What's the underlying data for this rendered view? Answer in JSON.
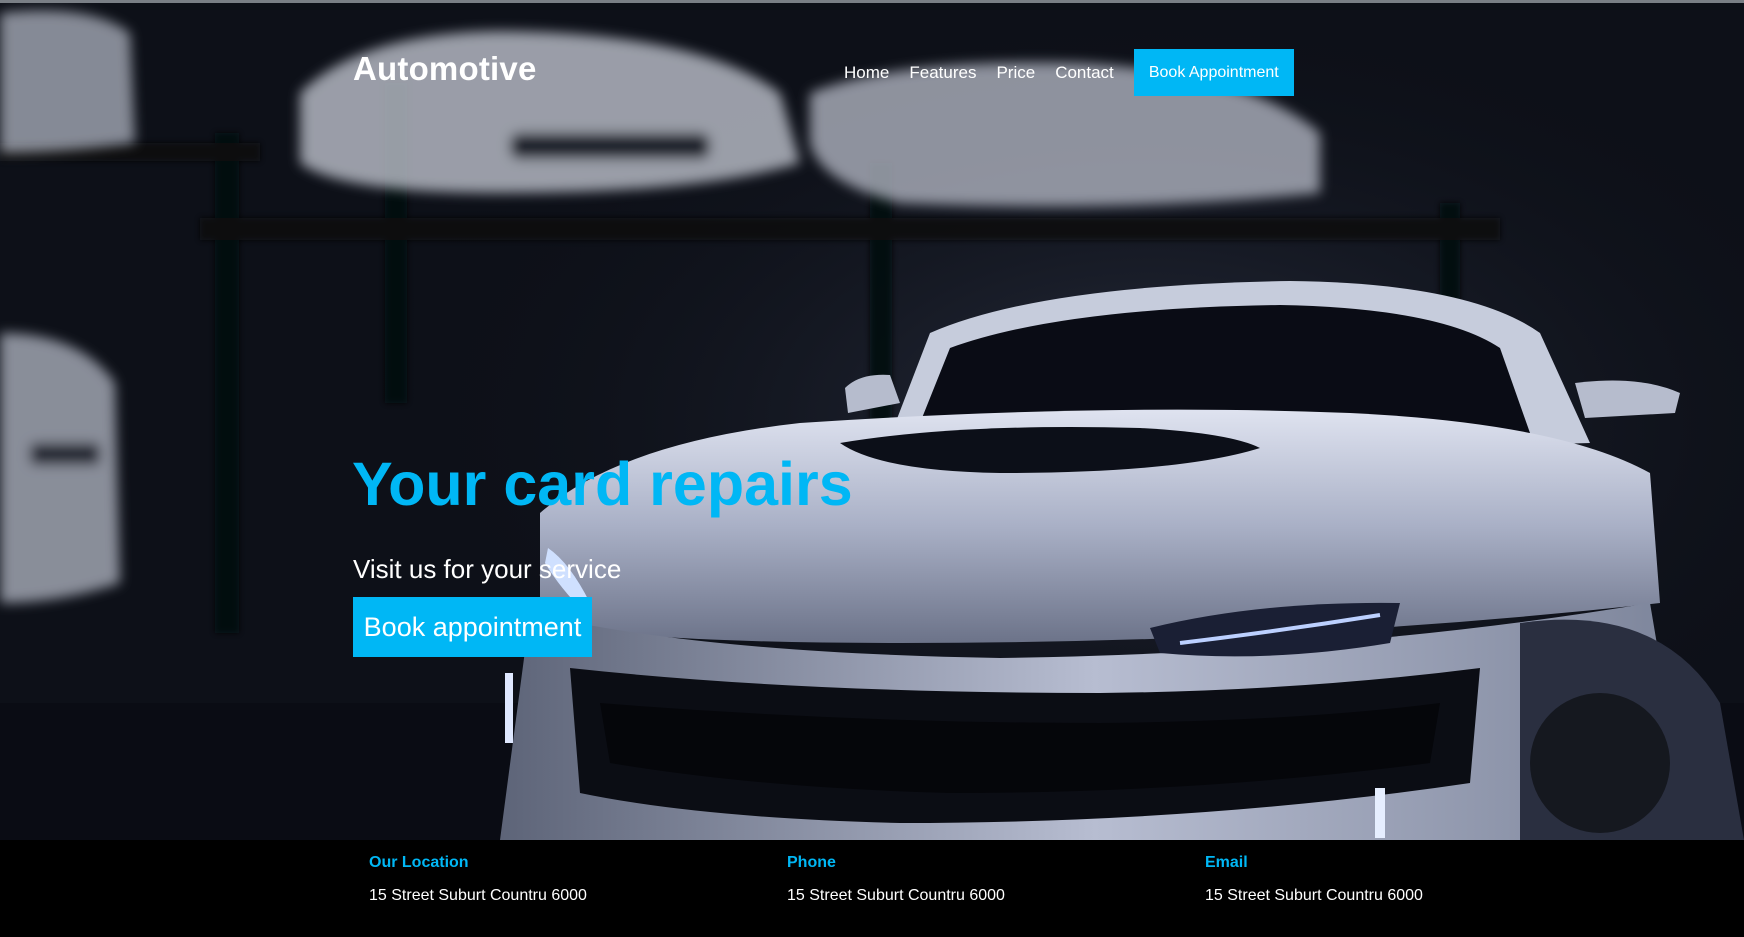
{
  "header": {
    "brand": "Automotive",
    "nav": [
      "Home",
      "Features",
      "Price",
      "Contact"
    ],
    "cta_label": "Book Appointment"
  },
  "hero": {
    "headline": "Your card repairs",
    "tagline": "Visit us for your service",
    "button_label": "Book appointment"
  },
  "footer": {
    "columns": [
      {
        "title": "Our Location",
        "value": "15 Street Suburt Countru 6000"
      },
      {
        "title": "Phone",
        "value": "15 Street Suburt Countru 6000"
      },
      {
        "title": "Email",
        "value": "15 Street Suburt Countru 6000"
      }
    ]
  },
  "colors": {
    "accent": "#00b7f5",
    "background": "#000000",
    "text": "#ffffff"
  }
}
